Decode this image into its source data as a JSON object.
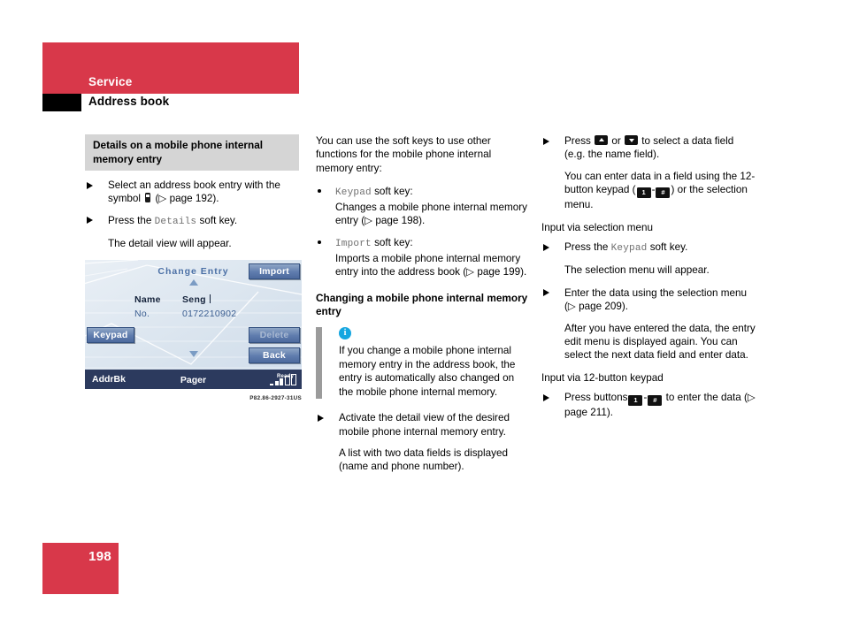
{
  "header": {
    "chapter": "Service",
    "section": "Address book"
  },
  "footer": {
    "page_number": "198"
  },
  "colors": {
    "brand_red": "#d8384a",
    "note_bar_gray": "#9b9b9b",
    "info_blue": "#15a6e0",
    "gray_title_bg": "#d5d5d5"
  },
  "col1": {
    "title": "Details on a mobile phone internal memory entry",
    "step1_a": "Select an address book entry with the symbol",
    "step1_b": "(▷ page 192).",
    "step2_a": "Press the",
    "step2_key": "Details",
    "step2_b": "soft key.",
    "result": "The detail view will appear.",
    "figure_caption": "P82.86-2927-31US"
  },
  "screen": {
    "title": "Change Entry",
    "rows": [
      {
        "label": "Name",
        "value": "Seng"
      },
      {
        "label": "No.",
        "value": "0172210902"
      }
    ],
    "softkeys": {
      "import": "Import",
      "delete": "Delete",
      "back": "Back",
      "keypad": "Keypad"
    },
    "status": {
      "left": "AddrBk",
      "middle": "Pager",
      "ready": "Ready"
    }
  },
  "col2": {
    "intro": "You can use the soft keys to use other functions for the mobile phone internal memory entry:",
    "bullets": [
      {
        "key": "Keypad",
        "key_suffix": "soft key:",
        "text": "Changes a mobile phone internal memory entry (▷ page 198)."
      },
      {
        "key": "Import",
        "key_suffix": "soft key:",
        "text": "Imports a mobile phone internal memory entry into the address book (▷ page 199)."
      }
    ],
    "heading": "Changing a mobile phone internal memory entry",
    "note": "If you change a mobile phone internal memory entry in the address book, the entry is automatically also changed on the mobile phone internal memory.",
    "step1": "Activate the detail view of the desired mobile phone internal memory entry.",
    "step1_result": "A list with two data fields is displayed (name and phone number)."
  },
  "col3": {
    "step1_a": "Press",
    "step1_or": "or",
    "step1_b": "to select a data field (e.g. the name field).",
    "para1_a": "You can enter data in a field using the 12-button keypad (",
    "key_one": "1",
    "key_dash": "-",
    "key_hash": "#",
    "para1_b": ") or the selection menu.",
    "subhead1": "Input via selection menu",
    "step2_a": "Press the",
    "step2_key": "Keypad",
    "step2_b": "soft key.",
    "step2_result": "The selection menu will appear.",
    "step3": "Enter the data using the selection menu (▷ page 209).",
    "step3_result": "After you have entered the data, the entry edit menu is displayed again. You can select the next data field and enter data.",
    "subhead2": "Input via 12-button keypad",
    "step4_a": "Press buttons",
    "step4_b": "to enter the data (▷ page 211)."
  }
}
